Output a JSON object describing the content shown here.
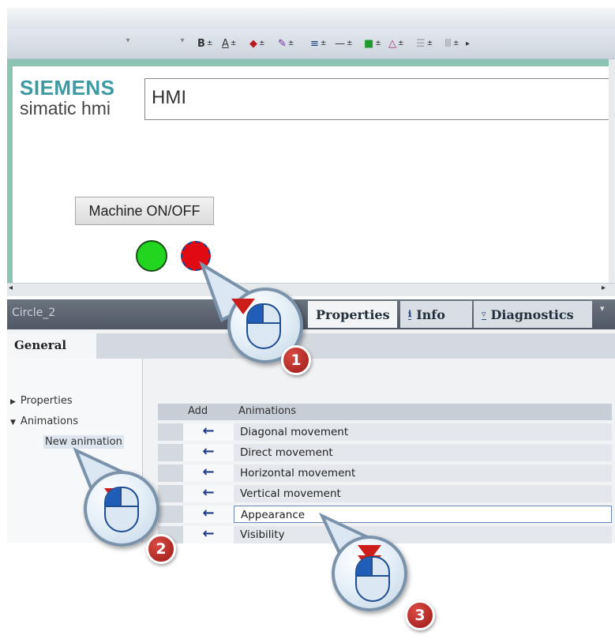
{
  "toolbar": {
    "buttons": [
      {
        "label": "B",
        "arrow": "±"
      },
      {
        "label": "A",
        "arrow": "±"
      },
      {
        "label": "◆",
        "arrow": "±"
      },
      {
        "label": "✎",
        "arrow": "±"
      },
      {
        "label": "≡",
        "arrow": "±"
      },
      {
        "label": "—",
        "arrow": "±"
      },
      {
        "label": "■",
        "arrow": "±"
      },
      {
        "label": "△",
        "arrow": "±"
      },
      {
        "label": "☰",
        "arrow": "±"
      },
      {
        "label": "Ⅲ",
        "arrow": "±"
      }
    ],
    "more_arrow": "▸"
  },
  "screen": {
    "brand": "SIEMENS",
    "brand_sub": "simatic hmi",
    "title": "HMI",
    "button_label": "Machine ON/OFF"
  },
  "inspector": {
    "object_name": "Circle_2",
    "tabs": {
      "properties": "Properties",
      "info": "Info",
      "diagnostics": "Diagnostics"
    },
    "general_tab": "General",
    "nav": {
      "properties": "Properties",
      "animations": "Animations",
      "new_animation": "New animation"
    },
    "table": {
      "col_add": "Add",
      "col_animations": "Animations",
      "rows": [
        {
          "name": "Diagonal movement",
          "icon": "←"
        },
        {
          "name": "Direct movement",
          "icon": "←"
        },
        {
          "name": "Horizontal movement",
          "icon": "←"
        },
        {
          "name": "Vertical movement",
          "icon": "←"
        },
        {
          "name": "Appearance",
          "icon": "←"
        },
        {
          "name": "Visibility",
          "icon": "←"
        }
      ]
    }
  },
  "callouts": {
    "one": "1",
    "two": "2",
    "three": "3"
  },
  "colors": {
    "brand": "#3d9aa2",
    "green_circle": "#22d51f",
    "red_circle": "#e20a12",
    "callout_badge": "#b52420",
    "click_arrow": "#cc1d1a"
  }
}
